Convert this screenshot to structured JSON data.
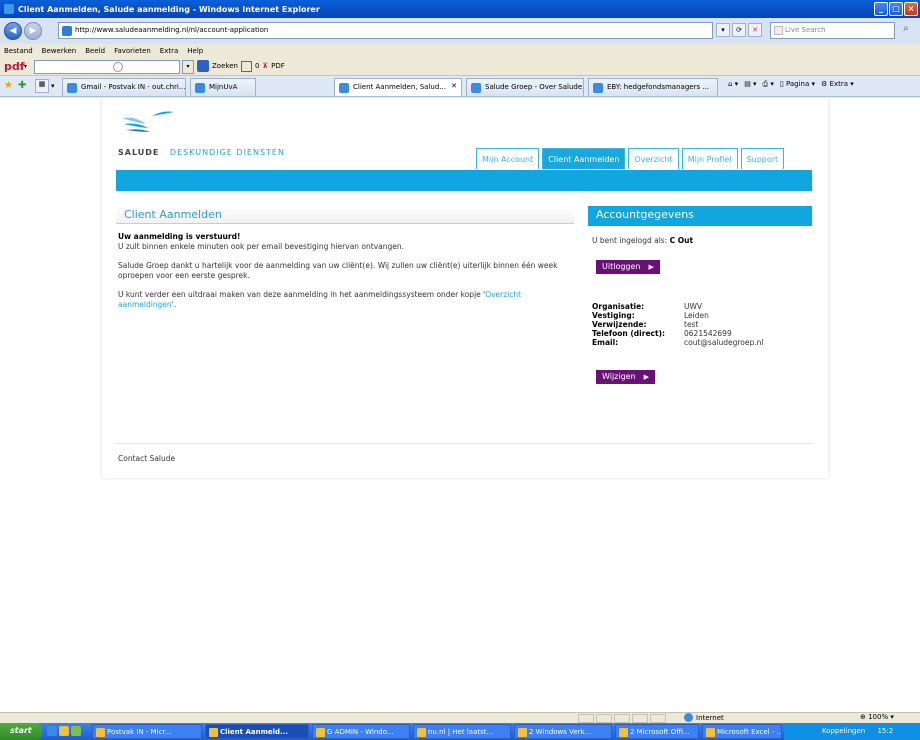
{
  "window": {
    "title": "Client Aanmelden, Salude aanmelding - Windows Internet Explorer",
    "controls": [
      "_",
      "□",
      "×"
    ]
  },
  "address": {
    "url": "http://www.saludeaanmelding.nl/nl/account-application",
    "live_search_placeholder": "Live Search"
  },
  "menubar": [
    "Bestand",
    "Bewerken",
    "Beeld",
    "Favorieten",
    "Extra",
    "Help"
  ],
  "pdfbar": {
    "logo": "pdf",
    "search_label": "Zoeken",
    "counter": "0",
    "pdf_label": "PDF"
  },
  "tabs": [
    {
      "label": "Gmail - Postvak IN - out.chri...",
      "active": false
    },
    {
      "label": "MijnUvA",
      "active": false
    },
    {
      "label": "Client Aanmelden, Salud...",
      "active": true
    },
    {
      "label": "Salude Groep - Over Salude...",
      "active": false
    },
    {
      "label": "EBY: hedgefondsmanagers ...",
      "active": false
    }
  ],
  "toolbar_right": [
    "Pagina",
    "Extra"
  ],
  "site": {
    "brand_a": "SALUDE",
    "brand_b": "DESKUNDIGE DIENSTEN",
    "nav": [
      {
        "label": "Mijn Account",
        "active": false
      },
      {
        "label": "Client Aanmelden",
        "active": true
      },
      {
        "label": "Overzicht",
        "active": false
      },
      {
        "label": "Mijn Profiel",
        "active": false
      },
      {
        "label": "Support",
        "active": false
      }
    ],
    "left_title": "Client Aanmelden",
    "message_strong": "Uw aanmelding is verstuurd!",
    "message_1": "U zult binnen enkele minuten ook per email bevestiging hiervan ontvangen.",
    "message_2": "Salude Groep dankt u hartelijk voor de aanmelding van uw cliënt(e). Wij zullen uw cliënt(e) uiterlijk binnen één week oproepen voor een eerste gesprek.",
    "message_3_pre": "U kunt verder een uitdraai maken van deze aanmelding in het aanmeldingssysteem onder kopje '",
    "message_3_link": "Overzicht aanmeldingen",
    "message_3_post": "'.",
    "right_title": "Accountgegevens",
    "logged_in_prefix": "U bent ingelogd als: ",
    "logged_in_user": "C Out",
    "logout_label": "Uitloggen",
    "edit_label": "Wijzigen",
    "account_info": [
      {
        "label": "Organisatie:",
        "value": "UWV"
      },
      {
        "label": "Vestiging:",
        "value": "Leiden"
      },
      {
        "label": "Verwijzende:",
        "value": "test"
      },
      {
        "label": "Telefoon (direct):",
        "value": "0621542699"
      },
      {
        "label": "Email:",
        "value": "cout@saludegroep.nl"
      }
    ],
    "footer_link": "Contact Salude"
  },
  "statusbar": {
    "zone": "Internet",
    "zoom": "100%"
  },
  "taskbar": {
    "start": "start",
    "buttons": [
      {
        "label": "Postvak IN - Micr...",
        "active": false
      },
      {
        "label": "Client Aanmeld...",
        "active": true
      },
      {
        "label": "G ADMIN - Windo...",
        "active": false
      },
      {
        "label": "nu.nl | Het laatst...",
        "active": false
      },
      {
        "label": "2 Windows Verk...",
        "active": false
      },
      {
        "label": "2 Microsoft Offi...",
        "active": false
      },
      {
        "label": "Microsoft Excel - ...",
        "active": false
      }
    ],
    "tray_label": "Koppelingen",
    "clock": "15:2"
  }
}
